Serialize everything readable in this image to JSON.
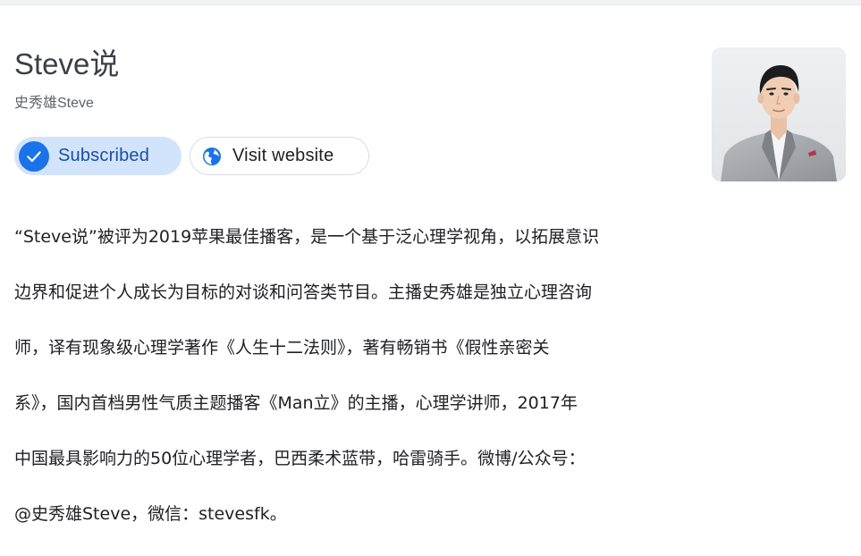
{
  "header": {
    "title": "Steve说",
    "author": "史秀雄Steve"
  },
  "actions": {
    "subscribed_label": "Subscribed",
    "visit_label": "Visit website",
    "check_icon": "check-icon",
    "globe_icon": "globe-icon"
  },
  "description": {
    "lines": [
      "“Steve说”被评为2019苹果最佳播客，是一个基于泛心理学视角，以拓展意识",
      "边界和促进个人成长为目标的对谈和问答类节目。主播史秀雄是独立心理咨询",
      "师，译有现象级心理学著作《人生十二法则》，著有畅销书《假性亲密关",
      "系》，国内首档男性气质主题播客《Man立》的主播，心理学讲师，2017年",
      "中国最具影响力的50位心理学者，巴西柔术蓝带，哈雷骑手。微博/公众号：",
      "@史秀雄Steve，微信：stevesfk。"
    ]
  },
  "colors": {
    "accent": "#1a73e8",
    "subscribed_bg": "#d2e3fc",
    "subscribed_text": "#174ea6",
    "text_primary": "#202124",
    "text_secondary": "#5f6368"
  }
}
